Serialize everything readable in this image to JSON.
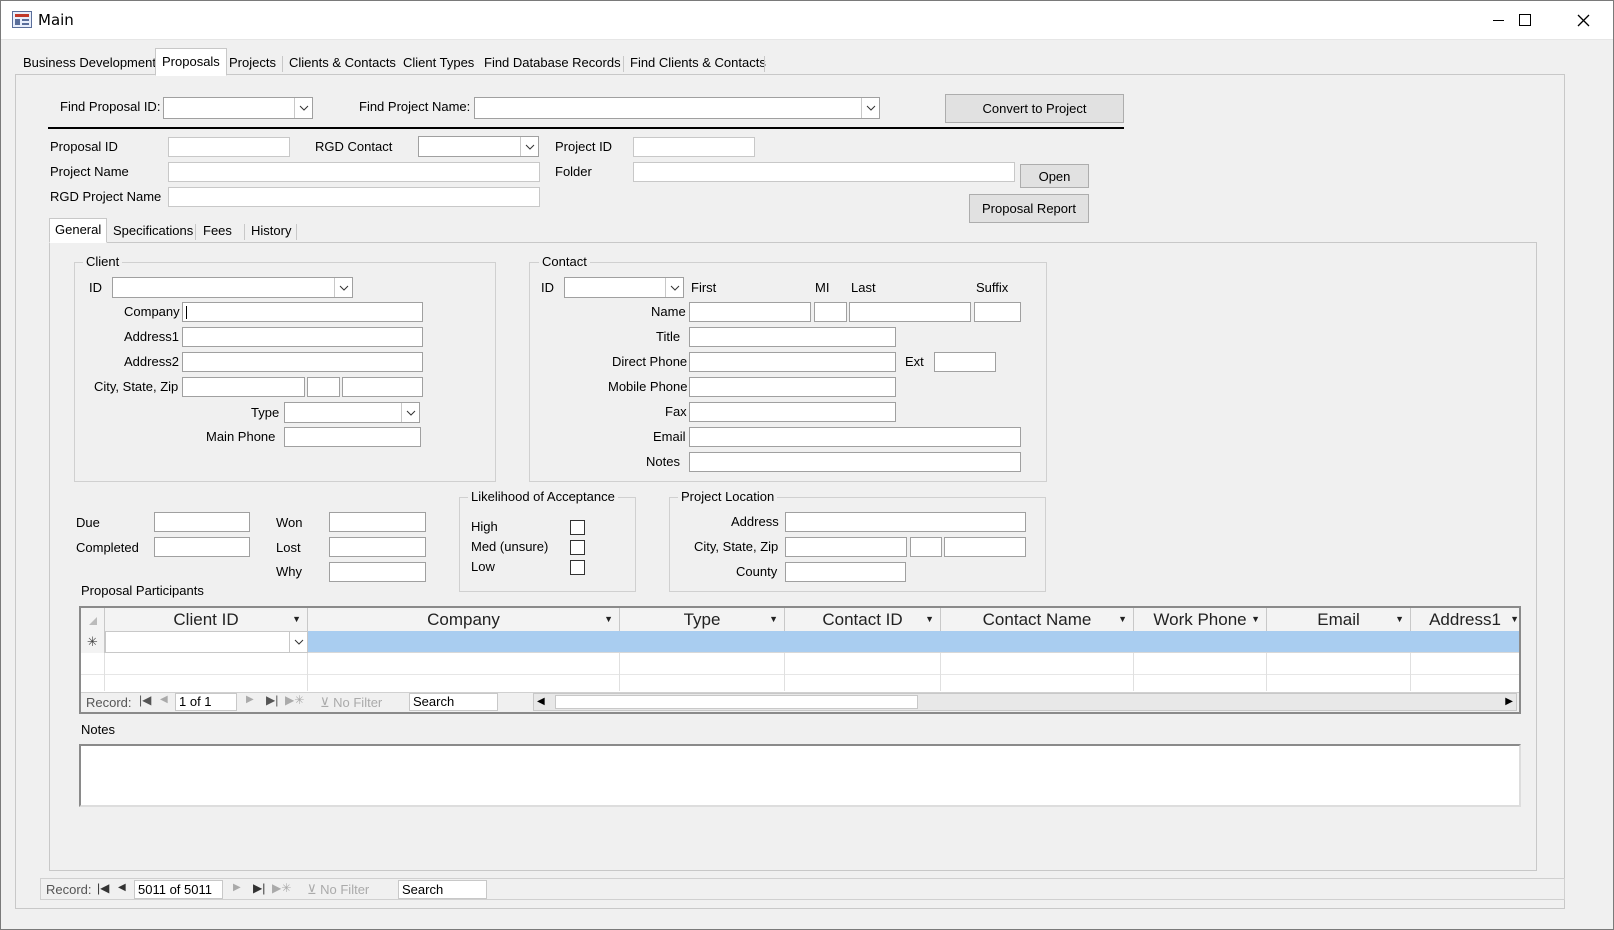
{
  "window": {
    "title": "Main"
  },
  "main_tabs": [
    "Business Development",
    "Proposals",
    "Projects",
    "Clients & Contacts",
    "Client Types",
    "Find Database Records",
    "Find Clients & Contacts"
  ],
  "find": {
    "proposal_id_label": "Find Proposal ID:",
    "project_name_label": "Find Project Name:",
    "convert_button": "Convert to Project"
  },
  "header_fields": {
    "proposal_id": "Proposal ID",
    "rgd_contact": "RGD Contact",
    "project_id": "Project ID",
    "project_name": "Project Name",
    "folder": "Folder",
    "rgd_project_name": "RGD Project Name",
    "open_button": "Open",
    "report_button": "Proposal Report"
  },
  "sub_tabs": [
    "General",
    "Specifications",
    "Fees",
    "History"
  ],
  "client": {
    "group": "Client",
    "id": "ID",
    "company": "Company",
    "address1": "Address1",
    "address2": "Address2",
    "city_state_zip": "City, State, Zip",
    "type": "Type",
    "main_phone": "Main Phone"
  },
  "contact": {
    "group": "Contact",
    "id": "ID",
    "first": "First",
    "mi": "MI",
    "last": "Last",
    "suffix": "Suffix",
    "name": "Name",
    "title": "Title",
    "direct_phone": "Direct Phone",
    "ext": "Ext",
    "mobile_phone": "Mobile Phone",
    "fax": "Fax",
    "email": "Email",
    "notes": "Notes"
  },
  "dates": {
    "due": "Due",
    "completed": "Completed",
    "won": "Won",
    "lost": "Lost",
    "why": "Why"
  },
  "likelihood": {
    "group": "Likelihood of Acceptance",
    "high": "High",
    "med": "Med (unsure)",
    "low": "Low"
  },
  "location": {
    "group": "Project Location",
    "address": "Address",
    "city_state_zip": "City, State, Zip",
    "county": "County"
  },
  "participants": {
    "label": "Proposal Participants",
    "columns": [
      "Client ID",
      "Company",
      "Type",
      "Contact ID",
      "Contact Name",
      "Work Phone",
      "Email",
      "Address1"
    ],
    "new_row_marker": "✳",
    "nav": {
      "record_label": "Record:",
      "position": "1 of 1",
      "filter": "No Filter",
      "search": "Search"
    }
  },
  "notes_label": "Notes",
  "form_nav": {
    "record_label": "Record:",
    "position": "5011 of 5011",
    "filter": "No Filter",
    "search": "Search"
  },
  "colors": {
    "selection_row": "#a9cdf0",
    "window_bg": "#f0f0f0"
  }
}
